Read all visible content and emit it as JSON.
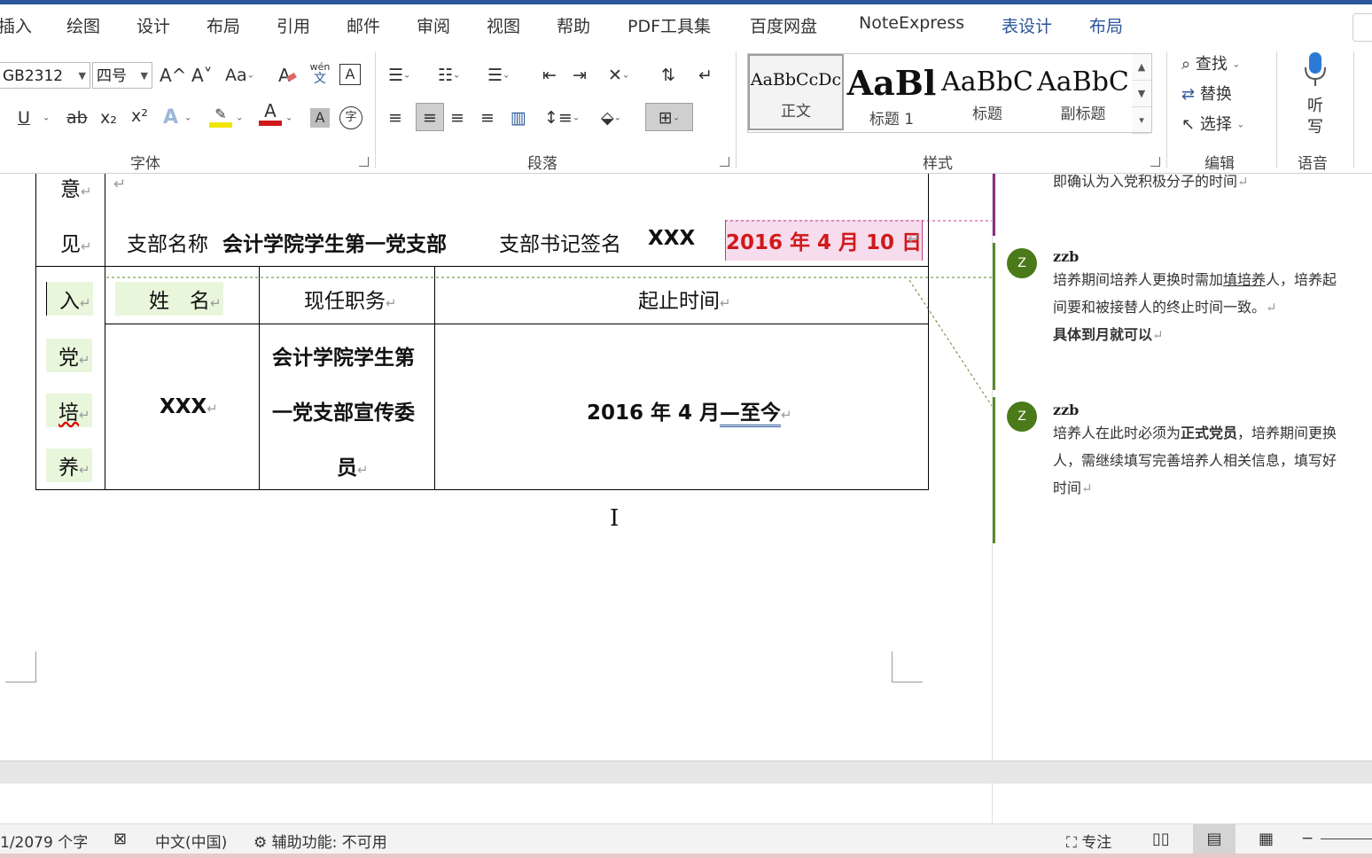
{
  "ribbon_tabs": [
    "插入",
    "绘图",
    "设计",
    "布局",
    "引用",
    "邮件",
    "审阅",
    "视图",
    "帮助",
    "PDF工具集",
    "百度网盘",
    "NoteExpress",
    "表设计",
    "布局"
  ],
  "font": {
    "name": "GB2312",
    "size": "四号",
    "grow_label": "A^",
    "shrink_label": "A˅",
    "case_label": "Aa",
    "clear_label": "A",
    "phonetic_top": "wén",
    "phonetic_bottom": "文",
    "border_label": "A",
    "underline_label": "U",
    "strike_label": "ab",
    "sub_label": "x₂",
    "sup_label": "x²",
    "effects_label": "A",
    "color_label": "A",
    "shading_label": "A",
    "enclose_label": "字",
    "group_label": "字体",
    "highlight_color": "#f2e600",
    "font_color": "#d0191a"
  },
  "paragraph": {
    "group_label": "段落"
  },
  "styles": {
    "items": [
      {
        "sample": "AaBbCcDc",
        "name": "正文"
      },
      {
        "sample": "AaBl",
        "name": "标题 1"
      },
      {
        "sample": "AaBbC",
        "name": "标题"
      },
      {
        "sample": "AaBbC",
        "name": "副标题"
      }
    ],
    "group_label": "样式"
  },
  "editing": {
    "find": "查找",
    "replace": "替换",
    "select": "选择",
    "group_label": "编辑"
  },
  "voice": {
    "dictate": "听写",
    "group_label": "语音"
  },
  "document": {
    "opinion_char1": "意",
    "opinion_char2": "见",
    "branch_name_label": "支部名称",
    "branch_name": "会计学院学生第一党支部",
    "secretary_label": "支部书记签名",
    "secretary": "XXX",
    "date": "2016 年 4 月 10 日",
    "vertical_chars": [
      "入",
      "党",
      "培",
      "养"
    ],
    "headers": {
      "name": "姓　名",
      "position": "现任职务",
      "period": "起止时间"
    },
    "row": {
      "name": "XXX",
      "position_lines": [
        "会计学院学生第",
        "一党支部宣传委",
        "员"
      ],
      "period_prefix": "2016 年 4 月",
      "period_suffix": "—至今"
    },
    "paragraph_mark": "↵"
  },
  "comments": {
    "top_fragment": "即确认为入党积极分子的时间",
    "items": [
      {
        "avatar": "Z",
        "author": "zzb",
        "lines": [
          {
            "pre": "培养期间培养人更换时需加",
            "u": "填培养",
            "post": "人，培养起"
          },
          {
            "pre": "间要和被接替人的终止时间一致。",
            "u": "",
            "post": ""
          }
        ],
        "bold_line": "具体到月就可以"
      },
      {
        "avatar": "Z",
        "author": "zzb",
        "line1_pre": "培养人在此时必须为",
        "line1_bold": "正式党员",
        "line1_post": "，培养期间更换",
        "line2": "人，需继续填写完善培养人相关信息，填写好",
        "line3": "时间"
      }
    ]
  },
  "status": {
    "word_count": "1/2079 个字",
    "language": "中文(中国)",
    "accessibility": "辅助功能: 不可用",
    "focus": "专注"
  }
}
